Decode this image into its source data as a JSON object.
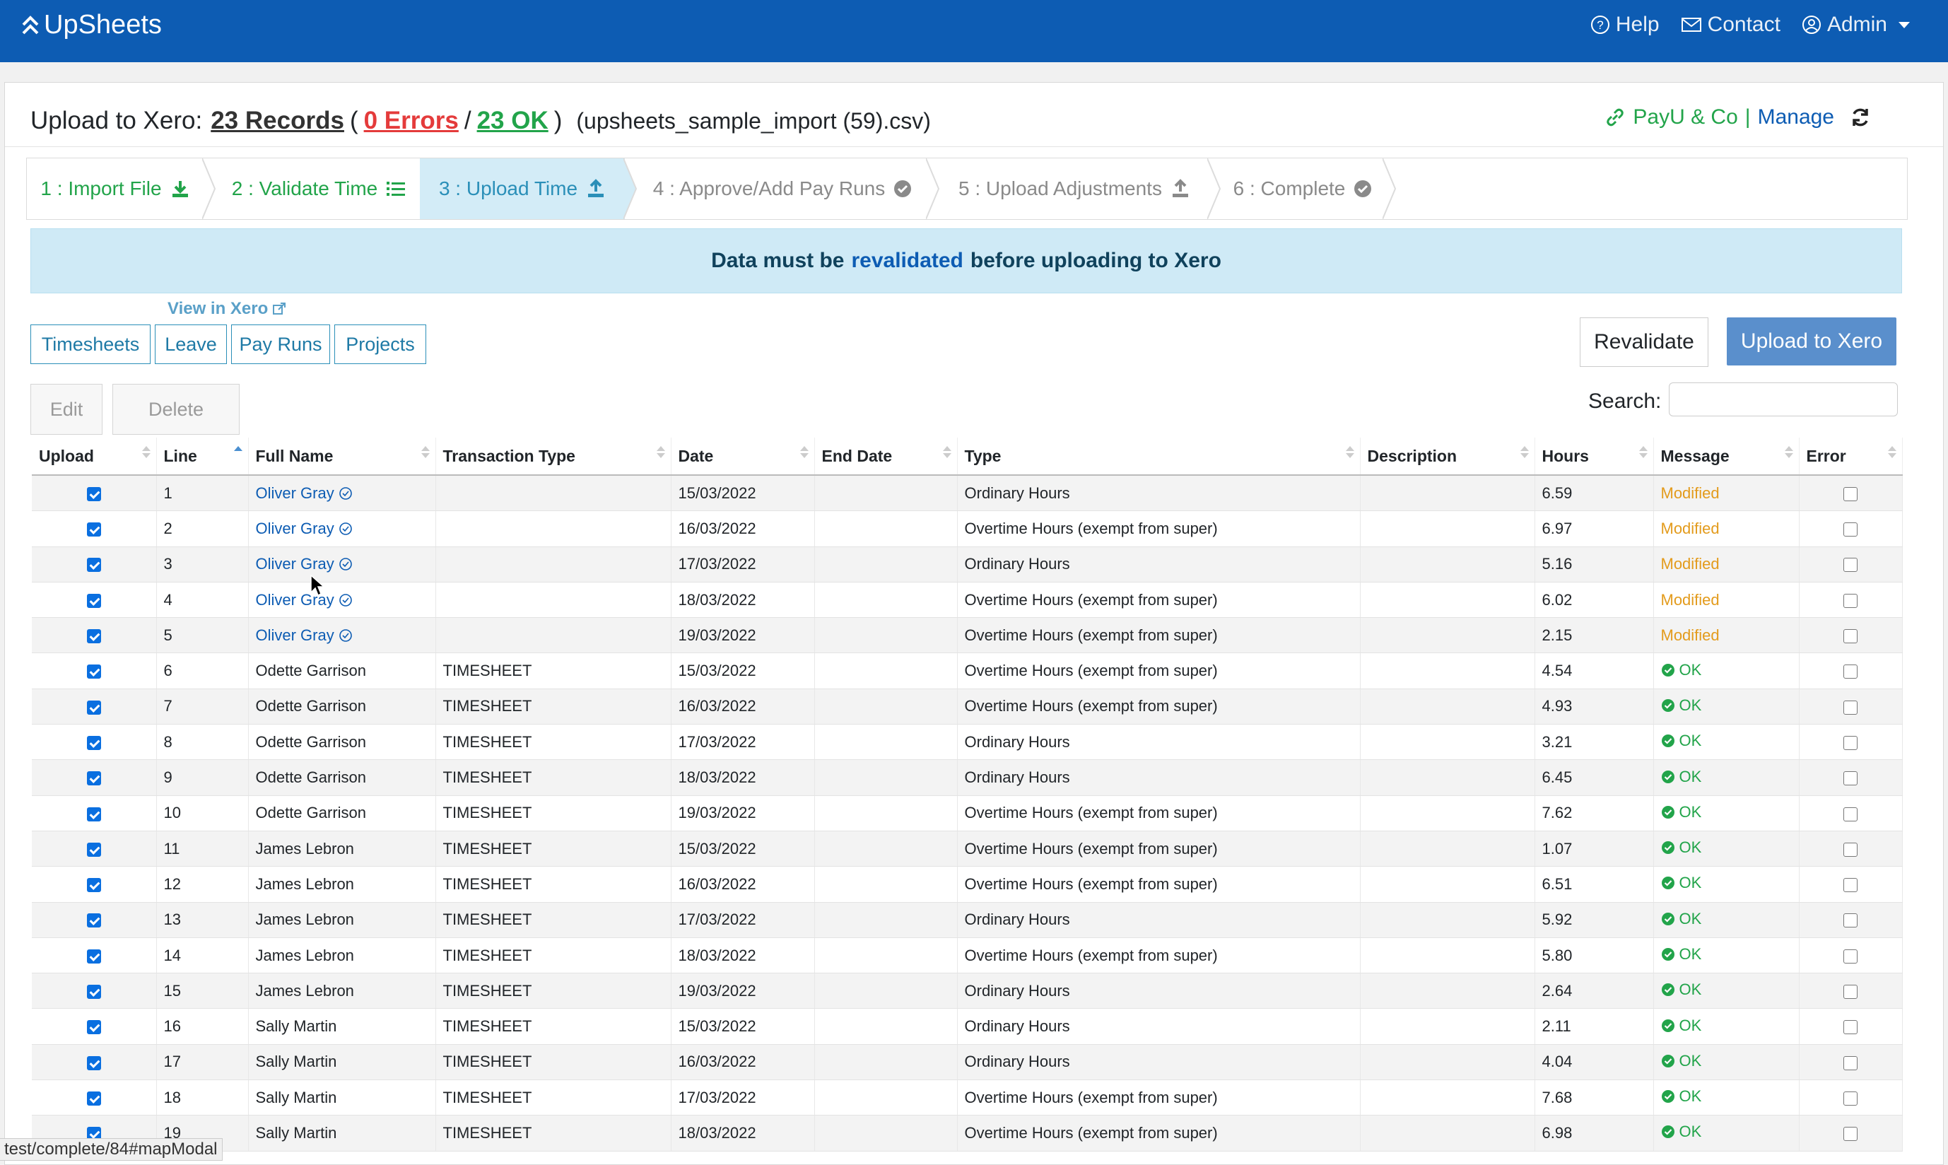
{
  "navbar": {
    "brand": "UpSheets",
    "help": "Help",
    "contact": "Contact",
    "admin": "Admin"
  },
  "header": {
    "title": "Upload to Xero:",
    "records": "23 Records",
    "open_paren": "(",
    "errors": "0 Errors",
    "slash": "/",
    "ok": "23 OK",
    "close_paren": ")",
    "filename": "(upsheets_sample_import (59).csv)",
    "org_name": "PayU & Co",
    "org_sep": "|",
    "manage": "Manage"
  },
  "steps": [
    {
      "label": "1 : Import File",
      "state": "done",
      "icon": "download-icon"
    },
    {
      "label": "2 : Validate Time",
      "state": "done",
      "icon": "list-icon"
    },
    {
      "label": "3 : Upload Time",
      "state": "active",
      "icon": "upload-icon"
    },
    {
      "label": "4 : Approve/Add Pay Runs",
      "state": "todo",
      "icon": "check-circle-icon"
    },
    {
      "label": "5 : Upload Adjustments",
      "state": "todo",
      "icon": "upload-icon"
    },
    {
      "label": "6 : Complete",
      "state": "todo",
      "icon": "check-circle-icon"
    }
  ],
  "alert": {
    "pre": "Data must be",
    "highlight": "revalidated",
    "post": "before uploading to Xero"
  },
  "view_in_xero": "View in Xero",
  "tabs": [
    "Timesheets",
    "Leave",
    "Pay Runs",
    "Projects"
  ],
  "actions": {
    "revalidate": "Revalidate",
    "upload": "Upload to Xero",
    "edit": "Edit",
    "delete": "Delete",
    "search_label": "Search:"
  },
  "table": {
    "columns": [
      "Upload",
      "Line",
      "Full Name",
      "Transaction Type",
      "Date",
      "End Date",
      "Type",
      "Description",
      "Hours",
      "Message",
      "Error"
    ],
    "rows": [
      {
        "upload": true,
        "line": "1",
        "name": "Oliver Gray",
        "linked": true,
        "trans": "",
        "date": "15/03/2022",
        "end": "",
        "type": "Ordinary Hours",
        "desc": "",
        "hours": "6.59",
        "message": "Modified",
        "error": false
      },
      {
        "upload": true,
        "line": "2",
        "name": "Oliver Gray",
        "linked": true,
        "trans": "",
        "date": "16/03/2022",
        "end": "",
        "type": "Overtime Hours (exempt from super)",
        "desc": "",
        "hours": "6.97",
        "message": "Modified",
        "error": false
      },
      {
        "upload": true,
        "line": "3",
        "name": "Oliver Gray",
        "linked": true,
        "trans": "",
        "date": "17/03/2022",
        "end": "",
        "type": "Ordinary Hours",
        "desc": "",
        "hours": "5.16",
        "message": "Modified",
        "error": false
      },
      {
        "upload": true,
        "line": "4",
        "name": "Oliver Gray",
        "linked": true,
        "trans": "",
        "date": "18/03/2022",
        "end": "",
        "type": "Overtime Hours (exempt from super)",
        "desc": "",
        "hours": "6.02",
        "message": "Modified",
        "error": false
      },
      {
        "upload": true,
        "line": "5",
        "name": "Oliver Gray",
        "linked": true,
        "trans": "",
        "date": "19/03/2022",
        "end": "",
        "type": "Overtime Hours (exempt from super)",
        "desc": "",
        "hours": "2.15",
        "message": "Modified",
        "error": false
      },
      {
        "upload": true,
        "line": "6",
        "name": "Odette Garrison",
        "linked": false,
        "trans": "TIMESHEET",
        "date": "15/03/2022",
        "end": "",
        "type": "Overtime Hours (exempt from super)",
        "desc": "",
        "hours": "4.54",
        "message": "OK",
        "error": false
      },
      {
        "upload": true,
        "line": "7",
        "name": "Odette Garrison",
        "linked": false,
        "trans": "TIMESHEET",
        "date": "16/03/2022",
        "end": "",
        "type": "Overtime Hours (exempt from super)",
        "desc": "",
        "hours": "4.93",
        "message": "OK",
        "error": false
      },
      {
        "upload": true,
        "line": "8",
        "name": "Odette Garrison",
        "linked": false,
        "trans": "TIMESHEET",
        "date": "17/03/2022",
        "end": "",
        "type": "Ordinary Hours",
        "desc": "",
        "hours": "3.21",
        "message": "OK",
        "error": false
      },
      {
        "upload": true,
        "line": "9",
        "name": "Odette Garrison",
        "linked": false,
        "trans": "TIMESHEET",
        "date": "18/03/2022",
        "end": "",
        "type": "Ordinary Hours",
        "desc": "",
        "hours": "6.45",
        "message": "OK",
        "error": false
      },
      {
        "upload": true,
        "line": "10",
        "name": "Odette Garrison",
        "linked": false,
        "trans": "TIMESHEET",
        "date": "19/03/2022",
        "end": "",
        "type": "Overtime Hours (exempt from super)",
        "desc": "",
        "hours": "7.62",
        "message": "OK",
        "error": false
      },
      {
        "upload": true,
        "line": "11",
        "name": "James Lebron",
        "linked": false,
        "trans": "TIMESHEET",
        "date": "15/03/2022",
        "end": "",
        "type": "Overtime Hours (exempt from super)",
        "desc": "",
        "hours": "1.07",
        "message": "OK",
        "error": false
      },
      {
        "upload": true,
        "line": "12",
        "name": "James Lebron",
        "linked": false,
        "trans": "TIMESHEET",
        "date": "16/03/2022",
        "end": "",
        "type": "Overtime Hours (exempt from super)",
        "desc": "",
        "hours": "6.51",
        "message": "OK",
        "error": false
      },
      {
        "upload": true,
        "line": "13",
        "name": "James Lebron",
        "linked": false,
        "trans": "TIMESHEET",
        "date": "17/03/2022",
        "end": "",
        "type": "Ordinary Hours",
        "desc": "",
        "hours": "5.92",
        "message": "OK",
        "error": false
      },
      {
        "upload": true,
        "line": "14",
        "name": "James Lebron",
        "linked": false,
        "trans": "TIMESHEET",
        "date": "18/03/2022",
        "end": "",
        "type": "Overtime Hours (exempt from super)",
        "desc": "",
        "hours": "5.80",
        "message": "OK",
        "error": false
      },
      {
        "upload": true,
        "line": "15",
        "name": "James Lebron",
        "linked": false,
        "trans": "TIMESHEET",
        "date": "19/03/2022",
        "end": "",
        "type": "Ordinary Hours",
        "desc": "",
        "hours": "2.64",
        "message": "OK",
        "error": false
      },
      {
        "upload": true,
        "line": "16",
        "name": "Sally Martin",
        "linked": false,
        "trans": "TIMESHEET",
        "date": "15/03/2022",
        "end": "",
        "type": "Ordinary Hours",
        "desc": "",
        "hours": "2.11",
        "message": "OK",
        "error": false
      },
      {
        "upload": true,
        "line": "17",
        "name": "Sally Martin",
        "linked": false,
        "trans": "TIMESHEET",
        "date": "16/03/2022",
        "end": "",
        "type": "Ordinary Hours",
        "desc": "",
        "hours": "4.04",
        "message": "OK",
        "error": false
      },
      {
        "upload": true,
        "line": "18",
        "name": "Sally Martin",
        "linked": false,
        "trans": "TIMESHEET",
        "date": "17/03/2022",
        "end": "",
        "type": "Overtime Hours (exempt from super)",
        "desc": "",
        "hours": "7.68",
        "message": "OK",
        "error": false
      },
      {
        "upload": true,
        "line": "19",
        "name": "Sally Martin",
        "linked": false,
        "trans": "TIMESHEET",
        "date": "18/03/2022",
        "end": "",
        "type": "Overtime Hours (exempt from super)",
        "desc": "",
        "hours": "6.98",
        "message": "OK",
        "error": false
      }
    ]
  },
  "status_bar": "test/complete/84#mapModal",
  "colors": {
    "navbar": "#0d5cb3",
    "success": "#22a44a",
    "danger": "#e43b3b",
    "warning": "#e39b1c",
    "info": "#2a8fb8"
  }
}
